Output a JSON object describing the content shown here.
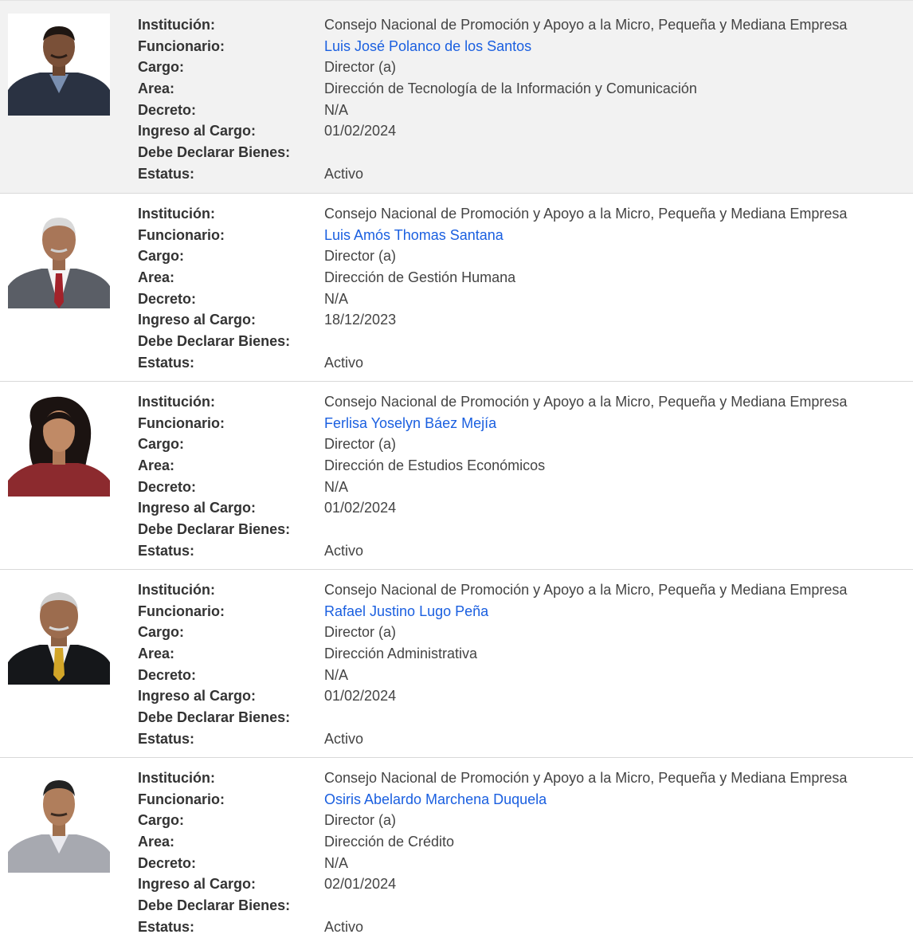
{
  "labels": {
    "institucion": "Institución:",
    "funcionario": "Funcionario:",
    "cargo": "Cargo:",
    "area": "Area:",
    "decreto": "Decreto:",
    "ingreso": "Ingreso al Cargo:",
    "declarar": "Debe Declarar Bienes:",
    "estatus": "Estatus:"
  },
  "colors": {
    "link": "#1a5fe0",
    "highlight_row": "#f2f2f2"
  },
  "records": [
    {
      "institucion": "Consejo Nacional de Promoción y Apoyo a la Micro, Pequeña y Mediana Empresa",
      "funcionario": "Luis José Polanco de los Santos",
      "cargo": "Director (a)",
      "area": "Dirección de Tecnología de la Información y Comunicación",
      "decreto": "N/A",
      "ingreso": "01/02/2024",
      "declarar": "",
      "estatus": "Activo"
    },
    {
      "institucion": "Consejo Nacional de Promoción y Apoyo a la Micro, Pequeña y Mediana Empresa",
      "funcionario": "Luis Amós Thomas Santana",
      "cargo": "Director (a)",
      "area": "Dirección de Gestión Humana",
      "decreto": "N/A",
      "ingreso": "18/12/2023",
      "declarar": "",
      "estatus": "Activo"
    },
    {
      "institucion": "Consejo Nacional de Promoción y Apoyo a la Micro, Pequeña y Mediana Empresa",
      "funcionario": "Ferlisa Yoselyn Báez Mejía",
      "cargo": "Director (a)",
      "area": "Dirección de Estudios Económicos",
      "decreto": "N/A",
      "ingreso": "01/02/2024",
      "declarar": "",
      "estatus": "Activo"
    },
    {
      "institucion": "Consejo Nacional de Promoción y Apoyo a la Micro, Pequeña y Mediana Empresa",
      "funcionario": "Rafael Justino Lugo Peña",
      "cargo": "Director (a)",
      "area": "Dirección Administrativa",
      "decreto": "N/A",
      "ingreso": "01/02/2024",
      "declarar": "",
      "estatus": "Activo"
    },
    {
      "institucion": "Consejo Nacional de Promoción y Apoyo a la Micro, Pequeña y Mediana Empresa",
      "funcionario": "Osiris Abelardo Marchena Duquela",
      "cargo": "Director (a)",
      "area": "Dirección de Crédito",
      "decreto": "N/A",
      "ingreso": "02/01/2024",
      "declarar": "",
      "estatus": "Activo"
    }
  ]
}
